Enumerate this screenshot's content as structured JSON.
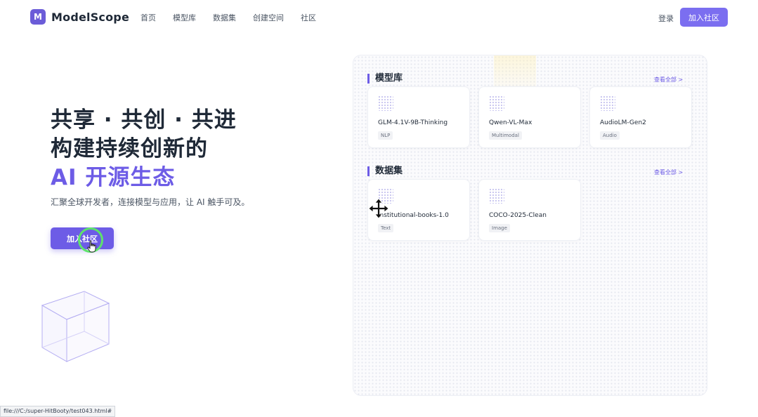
{
  "brand": {
    "logo_letter": "M",
    "name": "ModelScope",
    "color": "#6b5cd8"
  },
  "nav": {
    "items": [
      "首页",
      "模型库",
      "数据集",
      "创建空间",
      "社区"
    ],
    "login": "登录",
    "join": "加入社区"
  },
  "hero": {
    "line1": "共享 · 共创 · 共进",
    "line2": "构建持续创新的",
    "line3": "AI 开源生态",
    "subtitle": "汇聚全球开发者，连接模型与应用，让 AI 触手可及。",
    "cta": "加入社区"
  },
  "models": {
    "title": "模型库",
    "view_all": "查看全部 >",
    "cards": [
      {
        "name": "GLM-4.1V-9B-Thinking",
        "tag": "NLP"
      },
      {
        "name": "Qwen-VL-Max",
        "tag": "Multimodal"
      },
      {
        "name": "AudioLM-Gen2",
        "tag": "Audio"
      }
    ]
  },
  "datasets": {
    "title": "数据集",
    "view_all": "查看全部 >",
    "cards": [
      {
        "name": "institutional-books-1.0",
        "tag": "Text"
      },
      {
        "name": "COCO-2025-Clean",
        "tag": "Image"
      }
    ]
  },
  "status_bar": {
    "url": "file:///C:/super-HitBooty/test043.html#"
  },
  "colors": {
    "accent": "#6d5ce6",
    "accent_light": "#7b6ef0",
    "click_ring": "#5ee36b"
  }
}
